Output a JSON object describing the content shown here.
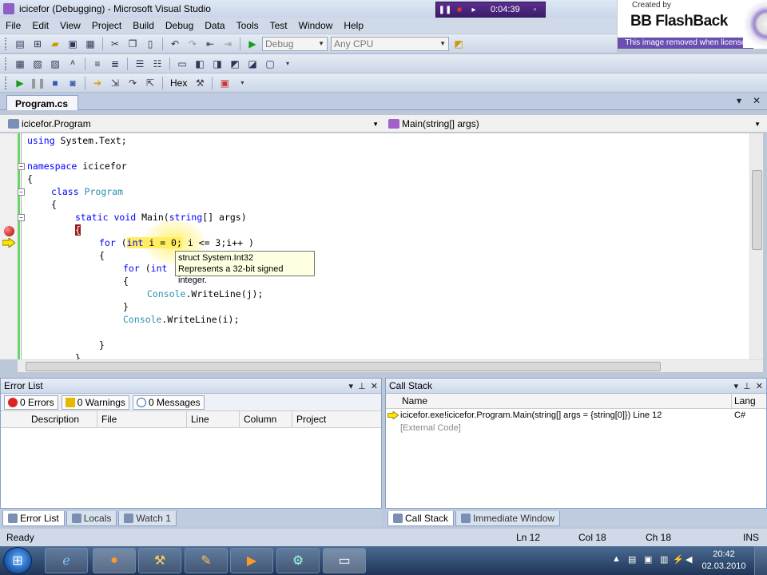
{
  "window": {
    "title": "icicefor (Debugging) - Microsoft Visual Studio"
  },
  "recorder": {
    "time": "0:04:39"
  },
  "watermark": {
    "created_by": "Created by",
    "brand": "BB FlashBack",
    "note": "This image removed when licensed"
  },
  "menu": [
    "File",
    "Edit",
    "View",
    "Project",
    "Build",
    "Debug",
    "Data",
    "Tools",
    "Test",
    "Window",
    "Help"
  ],
  "toolbar": {
    "config": "Debug",
    "platform": "Any CPU",
    "hex_label": "Hex"
  },
  "doc_tab": {
    "label": "Program.cs"
  },
  "nav": {
    "type_combo": "icicefor.Program",
    "member_combo": "Main(string[] args)"
  },
  "code": {
    "line1_kw": "using",
    "line1_rest": " System.Text;",
    "line2_kw": "namespace",
    "line2_rest": " icicefor",
    "brace_open": "{",
    "line3_kw": "class",
    "line3_ty": " Program",
    "line4_kw1": "static",
    "line4_kw2": " void",
    "line4_name": " Main(",
    "line4_kw3": "string",
    "line4_rest": "[] args)",
    "line5_brace": "{",
    "line6_kw": "for",
    "line6_paren": " (",
    "line6_hl_kw": "int",
    "line6_hl_rest": " i = 0;",
    "line6_rest": " i <= 3;i++ )",
    "line8_kw": "for",
    "line8_rest": " (",
    "line8_kw2": "int",
    "line10_ty": "Console",
    "line10_rest": ".WriteLine(j);",
    "brace_close": "}",
    "line12_ty": "Console",
    "line12_rest": ".WriteLine(i);"
  },
  "tooltip": {
    "line1": "struct System.Int32",
    "line2": "Represents a 32-bit signed integer."
  },
  "error_list": {
    "title": "Error List",
    "errors": "0 Errors",
    "warnings": "0 Warnings",
    "messages": "0 Messages",
    "columns": [
      "Description",
      "File",
      "Line",
      "Column",
      "Project"
    ]
  },
  "call_stack": {
    "title": "Call Stack",
    "columns": [
      "Name",
      "Lang"
    ],
    "rows": [
      {
        "name": "icicefor.exe!icicefor.Program.Main(string[] args = {string[0]}) Line 12",
        "lang": "C#"
      },
      {
        "name": "[External Code]",
        "lang": ""
      }
    ]
  },
  "bottom_tabs_left": [
    "Error List",
    "Locals",
    "Watch 1"
  ],
  "bottom_tabs_right": [
    "Call Stack",
    "Immediate Window"
  ],
  "status": {
    "ready": "Ready",
    "ln": "Ln 12",
    "col": "Col 18",
    "ch": "Ch 18",
    "mode": "INS"
  },
  "clock": {
    "time": "20:42",
    "date": "02.03.2010"
  },
  "colors": {
    "keyword": "#0000ff",
    "type": "#2b91af",
    "highlight": "#ffee62",
    "breakpoint": "#b00000"
  }
}
